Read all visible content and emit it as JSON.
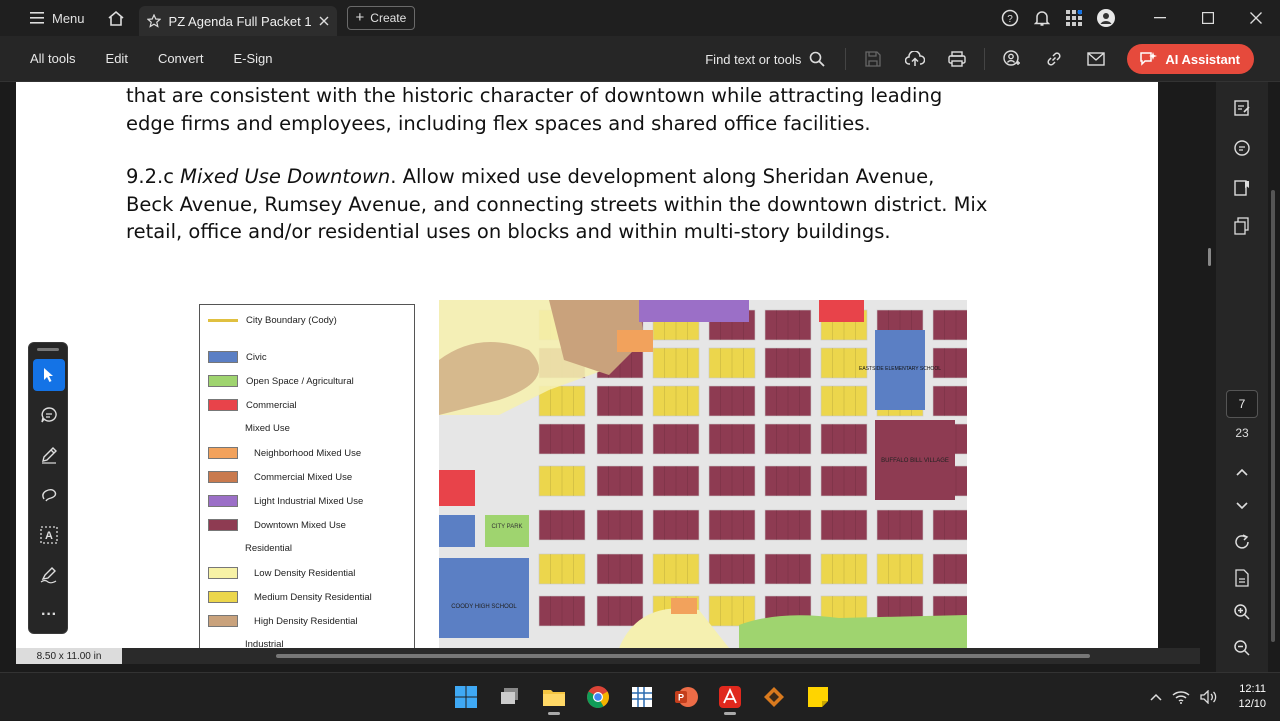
{
  "titlebar": {
    "menu_label": "Menu",
    "tab_title": "PZ Agenda Full Packet 1...",
    "create_label": "Create"
  },
  "toolbar": {
    "items": [
      "All tools",
      "Edit",
      "Convert",
      "E-Sign"
    ],
    "find_label": "Find text or tools",
    "ai_label": "AI Assistant"
  },
  "document": {
    "para1_line1": "that are consistent with the historic character of downtown while attracting leading",
    "para1_line2": "edge firms and employees, including flex spaces and shared office facilities.",
    "para2_num": "9.2.c ",
    "para2_title": "Mixed Use Downtown",
    "para2_rest1": ".  Allow mixed use development along Sheridan Avenue,",
    "para2_line2": "Beck Avenue, Rumsey Avenue, and connecting streets within the downtown district. Mix",
    "para2_line3": "retail, office and/or residential uses on blocks and within multi-story buildings.",
    "page_size": "8.50 x 11.00 in"
  },
  "legend": {
    "items": [
      {
        "label": "City Boundary (Cody)",
        "color": "#e0c040",
        "kind": "line"
      },
      {
        "label": "Civic",
        "color": "#5b7fc4",
        "kind": "swatch"
      },
      {
        "label": "Open Space / Agricultural",
        "color": "#9fd46f",
        "kind": "swatch"
      },
      {
        "label": "Commercial",
        "color": "#e8434a",
        "kind": "swatch"
      },
      {
        "label": "Mixed Use",
        "color": "",
        "kind": "heading"
      },
      {
        "label": "Neighborhood Mixed Use",
        "color": "#f2a25c",
        "kind": "swatch"
      },
      {
        "label": "Commercial Mixed Use",
        "color": "#c97a4e",
        "kind": "swatch"
      },
      {
        "label": "Light Industrial Mixed Use",
        "color": "#9b6fc7",
        "kind": "swatch"
      },
      {
        "label": "Downtown Mixed Use",
        "color": "#8e3b52",
        "kind": "swatch"
      },
      {
        "label": "Residential",
        "color": "",
        "kind": "heading"
      },
      {
        "label": "Low Density Residential",
        "color": "#f7f2a6",
        "kind": "swatch"
      },
      {
        "label": "Medium Density Residential",
        "color": "#ecd64c",
        "kind": "swatch"
      },
      {
        "label": "High Density Residential",
        "color": "#c9a27c",
        "kind": "swatch"
      },
      {
        "label": "Industrial",
        "color": "",
        "kind": "heading"
      }
    ]
  },
  "map": {
    "labels": [
      "CITY PARK",
      "COODY HIGH SCHOOL",
      "BUFFALO BILL VILLAGE",
      "EASTSIDE ELEMENTARY SCHOOL"
    ]
  },
  "page_nav": {
    "current": "7",
    "total": "23"
  },
  "clock": {
    "time": "12:11",
    "date": "12/10"
  },
  "colors": {
    "accent": "#1473e6",
    "ai": "#e64a3c"
  }
}
